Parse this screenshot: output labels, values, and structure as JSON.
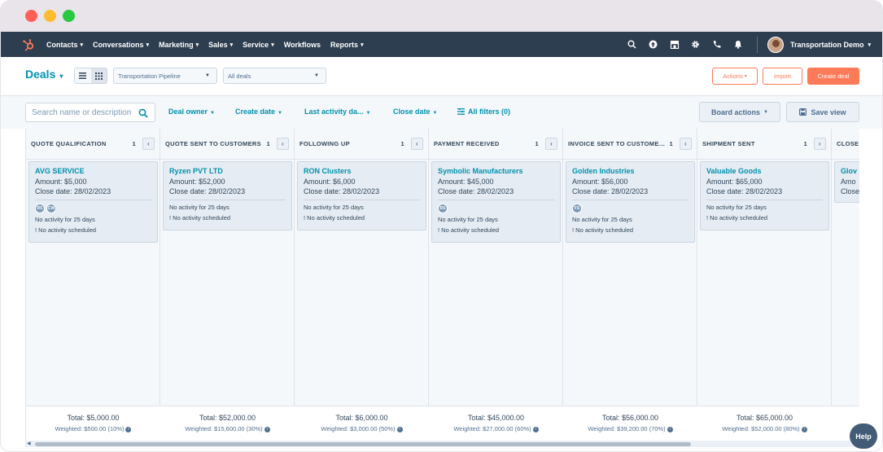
{
  "nav": {
    "items": [
      {
        "label": "Contacts",
        "dropdown": true
      },
      {
        "label": "Conversations",
        "dropdown": true
      },
      {
        "label": "Marketing",
        "dropdown": true
      },
      {
        "label": "Sales",
        "dropdown": true
      },
      {
        "label": "Service",
        "dropdown": true
      },
      {
        "label": "Workflows",
        "dropdown": false
      },
      {
        "label": "Reports",
        "dropdown": true
      }
    ],
    "account_name": "Transportation Demo",
    "accent_color": "#ff7a59",
    "bar_color": "#2d3e50"
  },
  "header": {
    "title": "Deals",
    "pipeline_select": "Transportation Pipeline",
    "deals_select": "All deals",
    "actions_label": "Actions",
    "import_label": "Import",
    "create_label": "Create deal"
  },
  "filters": {
    "search_placeholder": "Search name or description",
    "deal_owner": "Deal owner",
    "create_date": "Create date",
    "last_activity": "Last activity da...",
    "close_date": "Close date",
    "all_filters": "All filters (0)",
    "board_actions": "Board actions",
    "save_view": "Save view"
  },
  "columns": [
    {
      "name": "QUOTE QUALIFICATION",
      "count": "1",
      "card": {
        "name": "AVG SERVICE",
        "amount": "Amount: $5,000",
        "close": "Close date: 28/02/2023",
        "avatars": [
          "RS",
          "CW"
        ],
        "activity": "No activity for 25 days",
        "scheduled": "No activity scheduled"
      },
      "total": "Total: $5,000.00",
      "weighted": "Weighted: $500.00 (10%)"
    },
    {
      "name": "QUOTE SENT TO CUSTOMERS",
      "count": "1",
      "card": {
        "name": "Ryzen PVT LTD",
        "amount": "Amount: $52,000",
        "close": "Close date: 28/02/2023",
        "avatars": [],
        "activity": "No activity for 25 days",
        "scheduled": "No activity scheduled"
      },
      "total": "Total: $52,000.00",
      "weighted": "Weighted: $15,600.00 (30%)"
    },
    {
      "name": "FOLLOWING UP",
      "count": "1",
      "card": {
        "name": "RON Clusters",
        "amount": "Amount: $6,000",
        "close": "Close date: 28/02/2023",
        "avatars": [],
        "activity": "No activity for 25 days",
        "scheduled": "No activity scheduled"
      },
      "total": "Total: $6,000.00",
      "weighted": "Weighted: $3,000.00 (50%)"
    },
    {
      "name": "PAYMENT RECEIVED",
      "count": "1",
      "card": {
        "name": "Symbolic Manufacturers",
        "amount": "Amount: $45,000",
        "close": "Close date: 28/02/2023",
        "avatars": [
          "RS"
        ],
        "activity": "No activity for 25 days",
        "scheduled": "No activity scheduled"
      },
      "total": "Total: $45,000.00",
      "weighted": "Weighted: $27,000.00 (60%)"
    },
    {
      "name": "INVOICE SENT TO CUSTOMERS",
      "count": "1",
      "card": {
        "name": "Golden Industries",
        "amount": "Amount: $56,000",
        "close": "Close date: 28/02/2023",
        "avatars": [
          "FS"
        ],
        "activity": "No activity for 25 days",
        "scheduled": "No activity scheduled"
      },
      "total": "Total: $56,000.00",
      "weighted": "Weighted: $39,200.00 (70%)"
    },
    {
      "name": "SHIPMENT SENT",
      "count": "1",
      "card": {
        "name": "Valuable Goods",
        "amount": "Amount: $65,000",
        "close": "Close date: 28/02/2023",
        "avatars": [],
        "activity": "No activity for 25 days",
        "scheduled": "No activity scheduled"
      },
      "total": "Total: $65,000.00",
      "weighted": "Weighted: $52,000.00 (80%)"
    },
    {
      "name": "CLOSE",
      "count": "",
      "card": {
        "name": "Glov",
        "amount": "Amo",
        "close": "Close",
        "avatars": [],
        "activity": "",
        "scheduled": ""
      },
      "total": "",
      "weighted": ""
    }
  ],
  "help_label": "Help"
}
